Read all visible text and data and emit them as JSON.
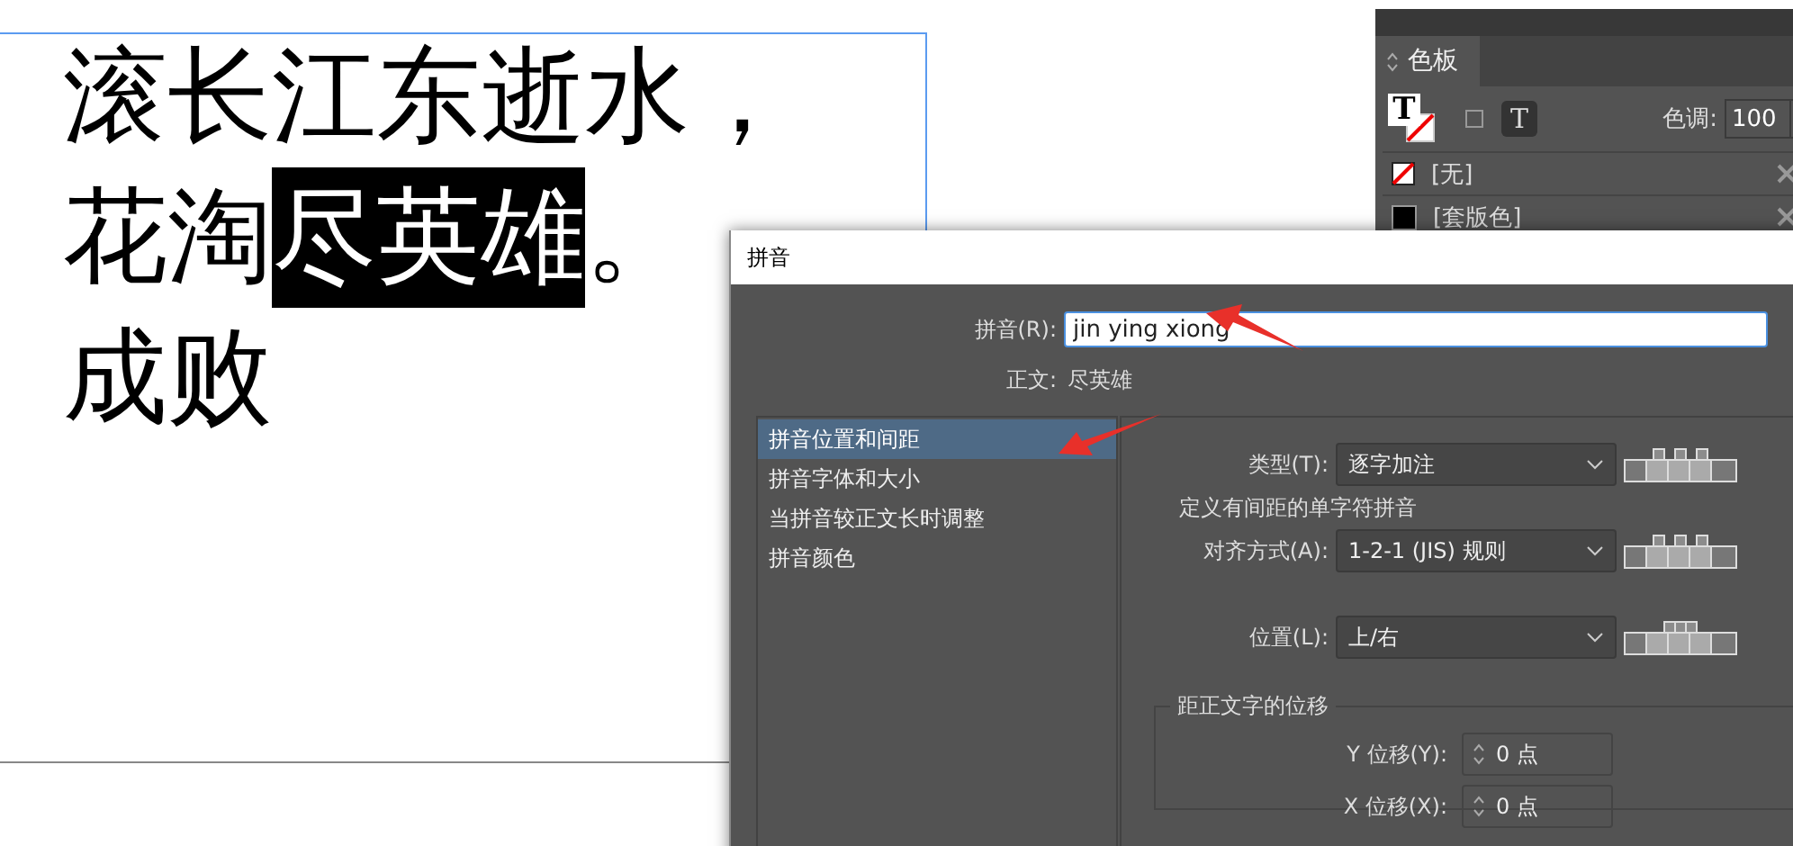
{
  "document": {
    "lines": [
      {
        "segments": [
          {
            "text": "滚长江东逝水，",
            "selected": false
          }
        ]
      },
      {
        "segments": [
          {
            "text": "花淘",
            "selected": false
          },
          {
            "text": "尽英雄",
            "selected": true
          },
          {
            "text": "。",
            "selected": false
          }
        ]
      },
      {
        "segments": [
          {
            "text": "成败",
            "selected": false
          }
        ]
      }
    ]
  },
  "swatches_panel": {
    "tab": "色板",
    "fill_glyph": "T",
    "text_button": "T",
    "tint_label": "色调:",
    "tint_value": "100",
    "swatches": [
      {
        "name": "[无]",
        "kind": "none"
      },
      {
        "name": "[套版色]",
        "kind": "solid",
        "color": "#000000"
      }
    ]
  },
  "dialog": {
    "title": "拼音",
    "ruby_label": "拼音(R):",
    "ruby_value": "jin ying xiong",
    "base_label": "正文:",
    "base_value": "尽英雄",
    "categories": [
      {
        "label": "拼音位置和间距",
        "selected": true
      },
      {
        "label": "拼音字体和大小",
        "selected": false
      },
      {
        "label": "当拼音较正文长时调整",
        "selected": false
      },
      {
        "label": "拼音颜色",
        "selected": false
      }
    ],
    "settings": [
      {
        "kind": "dropdown",
        "label": "类型(T):",
        "value": "逐字加注",
        "grouped": false
      },
      {
        "kind": "note",
        "text": "定义有间距的单字符拼音"
      },
      {
        "kind": "dropdown",
        "label": "对齐方式(A):",
        "value": "1-2-1 (JIS) 规则",
        "grouped": false
      },
      {
        "kind": "dropdown",
        "label": "位置(L):",
        "value": "上/右",
        "grouped": true
      }
    ],
    "offset_group": {
      "title": "距正文字的位移",
      "fields": [
        {
          "label": "Y 位移(Y):",
          "value": "0 点"
        },
        {
          "label": "X 位移(X):",
          "value": "0 点"
        }
      ]
    }
  }
}
